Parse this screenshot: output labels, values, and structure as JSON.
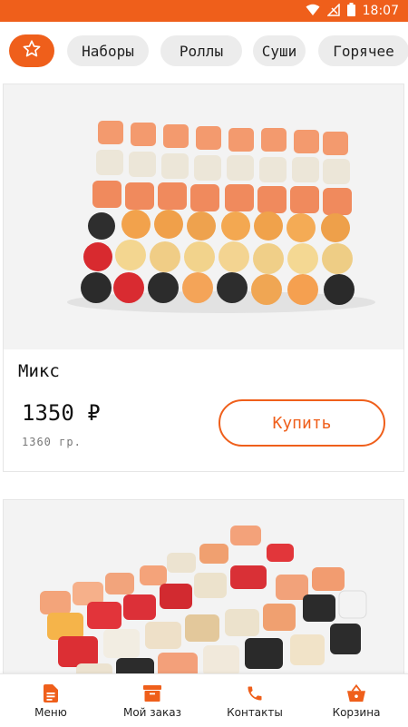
{
  "status_bar": {
    "time": "18:07"
  },
  "categories": {
    "favorite_icon": "star-icon",
    "items": [
      {
        "label": "Наборы"
      },
      {
        "label": "Роллы"
      },
      {
        "label": "Суши"
      },
      {
        "label": "Горячее"
      }
    ]
  },
  "products": [
    {
      "title": "Микс",
      "price": "1350 ₽",
      "weight": "1360 гр.",
      "buy_label": "Купить"
    },
    {
      "title": "",
      "price": "",
      "weight": "",
      "buy_label": ""
    }
  ],
  "bottom_nav": {
    "items": [
      {
        "label": "Меню",
        "icon": "document-icon"
      },
      {
        "label": "Мой заказ",
        "icon": "box-icon"
      },
      {
        "label": "Контакты",
        "icon": "phone-icon"
      },
      {
        "label": "Корзина",
        "icon": "basket-icon"
      }
    ]
  },
  "colors": {
    "accent": "#ef5f1b",
    "chip_bg": "#ececec"
  }
}
